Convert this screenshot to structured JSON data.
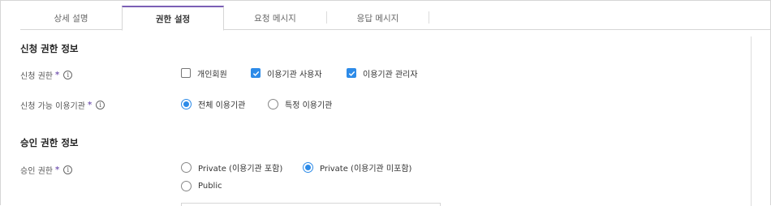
{
  "tabs": [
    {
      "label": "상세 설명"
    },
    {
      "label": "권한 설정"
    },
    {
      "label": "요청 메시지"
    },
    {
      "label": "응답 메시지"
    }
  ],
  "active_tab": "권한 설정",
  "sections": {
    "apply": {
      "title": "신청 권한 정보",
      "apply_permission": {
        "label": "신청 권한",
        "options": [
          {
            "label": "개인회원",
            "checked": false
          },
          {
            "label": "이용기관 사용자",
            "checked": true
          },
          {
            "label": "이용기관 관리자",
            "checked": true
          }
        ]
      },
      "available_org": {
        "label": "신청 가능 이용기관",
        "options": [
          {
            "label": "전체 이용기관",
            "selected": true
          },
          {
            "label": "특정 이용기관",
            "selected": false
          }
        ]
      }
    },
    "approval": {
      "title": "승인 권한 정보",
      "approval_permission": {
        "label": "승인 권한",
        "options": [
          {
            "label": "Private (이용기관 포함)",
            "selected": false
          },
          {
            "label": "Private (이용기관 미포함)",
            "selected": true
          },
          {
            "label": "Public",
            "selected": false
          }
        ]
      }
    }
  },
  "required_mark": "*",
  "info_glyph": "i",
  "colors": {
    "accent": "#2d8be8",
    "tab_active": "#7b5fb5",
    "required": "#7b5fb5"
  }
}
